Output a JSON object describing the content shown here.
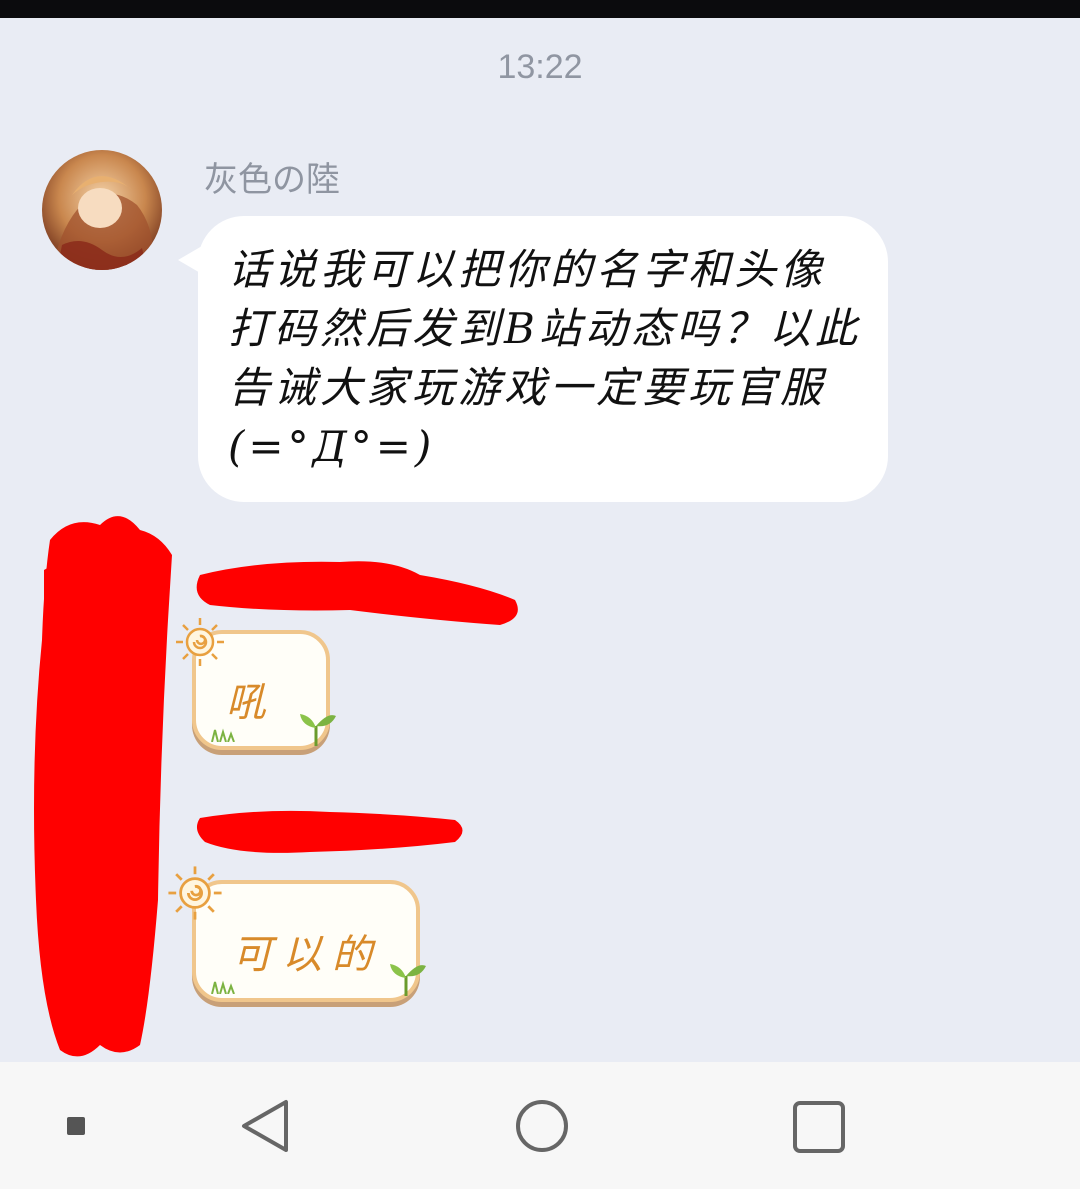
{
  "status": {
    "time": "13:22"
  },
  "messages": [
    {
      "sender": "灰色の陸",
      "text": "话说我可以把你的名字和头像打码然后发到B站动态吗？以此告诫大家玩游戏一定要玩官服(=°Д°=)"
    },
    {
      "sender": "",
      "text": "吼"
    },
    {
      "sender": "",
      "text": "可以的"
    }
  ],
  "navbar": {
    "icons": [
      "small-square-icon",
      "back-triangle-icon",
      "home-circle-icon",
      "recents-square-icon"
    ]
  },
  "colors": {
    "background": "#e9ecf4",
    "sticker_text": "#d88a2a",
    "redaction": "#ff0000"
  }
}
